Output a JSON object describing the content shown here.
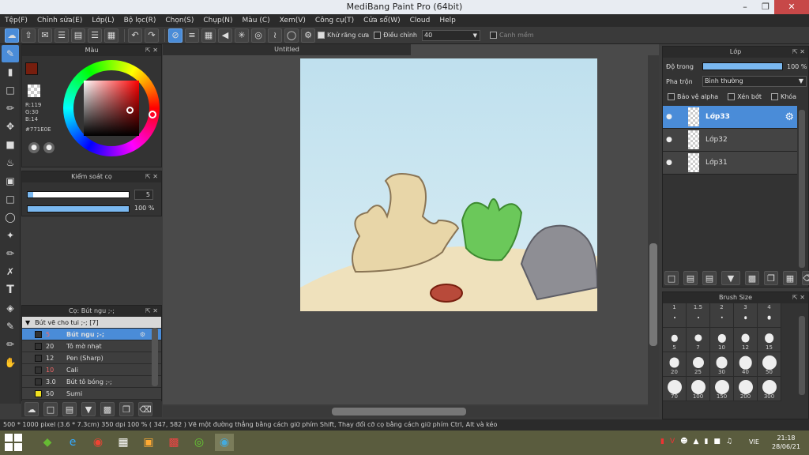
{
  "window": {
    "title": "MediBang Paint Pro (64bit)"
  },
  "menu": [
    "Tệp(F)",
    "Chỉnh sửa(E)",
    "Lớp(L)",
    "Bộ lọc(R)",
    "Chọn(S)",
    "Chụp(N)",
    "Màu (C)",
    "Xem(V)",
    "Công cụ(T)",
    "Cửa sổ(W)",
    "Cloud",
    "Help"
  ],
  "toolbar": {
    "antialias_label": "Khử răng cưa",
    "adjust_label": "Điều chỉnh",
    "adjust_value": "40",
    "smooth_label": "Canh mềm"
  },
  "color_panel": {
    "title": "Màu",
    "r": "R:119",
    "g": "G:30",
    "b": "B:14",
    "hex": "#771E0E",
    "primary": "#771E0E"
  },
  "brush_control": {
    "title": "Kiểm soát cọ",
    "size": "5",
    "opacity": "100 %"
  },
  "brush_panel": {
    "title": "Cọ: Bút ngu ;-;",
    "group": "Bút vẽ cho tui ;-; [7]",
    "items": [
      {
        "size": "5",
        "name": "Bút ngu ;-;",
        "color": "#333333",
        "selected": true
      },
      {
        "size": "20",
        "name": "Tô mờ nhạt",
        "color": "#333333"
      },
      {
        "size": "12",
        "name": "Pen (Sharp)",
        "color": "#333333"
      },
      {
        "size": "10",
        "name": "Cali",
        "color": "#333333"
      },
      {
        "size": "3.0",
        "name": "Bút tô bóng ;-;",
        "color": "#333333"
      },
      {
        "size": "50",
        "name": "Sumi",
        "color": "#f0e020"
      }
    ]
  },
  "canvas": {
    "tab": "Untitled"
  },
  "layer_panel": {
    "title": "Lớp",
    "opacity_label": "Độ trong",
    "opacity_value": "100 %",
    "blend_label": "Pha trộn",
    "blend_value": "Bình thường",
    "protect_alpha": "Bảo vệ alpha",
    "clipping": "Xén bớt",
    "lock": "Khóa",
    "layers": [
      {
        "name": "Lớp33",
        "selected": true
      },
      {
        "name": "Lớp32"
      },
      {
        "name": "Lớp31"
      }
    ]
  },
  "brush_size": {
    "title": "Brush Size",
    "sizes": [
      "1",
      "1.5",
      "2",
      "3",
      "4",
      "5",
      "7",
      "10",
      "12",
      "15",
      "20",
      "25",
      "30",
      "40",
      "50",
      "70",
      "100",
      "150",
      "200",
      "300"
    ]
  },
  "status": {
    "text": "500 * 1000 pixel  (3.6 * 7.3cm)  350 dpi  100 %  ( 347, 582 )  Vẽ một đường thẳng bằng cách giữ phím Shift, Thay đổi cỡ cọ bằng cách giữ phím Ctrl, Alt và kéo"
  },
  "taskbar": {
    "lang": "VIE",
    "time": "21:18",
    "date": "28/06/21"
  }
}
